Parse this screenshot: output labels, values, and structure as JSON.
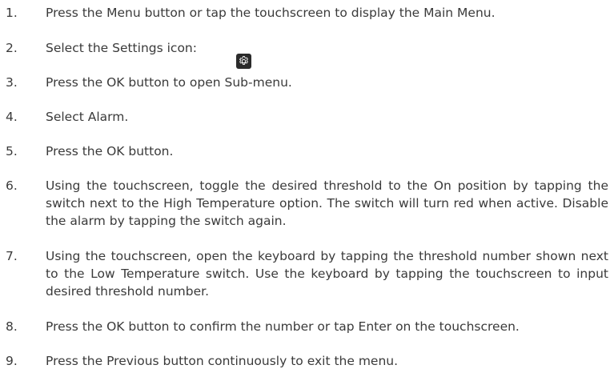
{
  "steps": [
    {
      "number": "1.",
      "text": "Press the Menu button or tap the touchscreen to display the Main Menu."
    },
    {
      "number": "2.",
      "text": "Select the Settings icon:"
    },
    {
      "number": "3.",
      "text": "Press the OK button to open Sub-menu."
    },
    {
      "number": "4.",
      "text": "Select Alarm."
    },
    {
      "number": "5.",
      "text": "Press the OK button."
    },
    {
      "number": "6.",
      "text": "Using the touchscreen, toggle the desired threshold to the On position by tapping the switch next to the High Temperature option. The switch will turn red when active. Disable the alarm by tapping the switch again."
    },
    {
      "number": "7.",
      "text": "Using the touchscreen, open the keyboard by tapping the threshold number shown next to the Low Temperature switch. Use the keyboard by tapping the touchscreen to input desired  threshold number."
    },
    {
      "number": "8.",
      "text": "Press the OK button to confirm the number or tap Enter on the touchscreen."
    },
    {
      "number": "9.",
      "text": "Press the Previous button continuously to exit the menu."
    }
  ],
  "icons": {
    "settings": "gear-icon"
  }
}
